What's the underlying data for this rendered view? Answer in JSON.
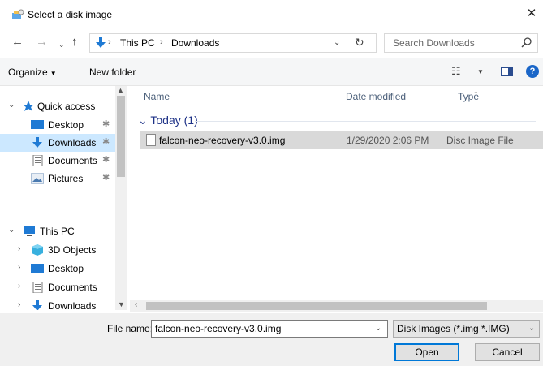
{
  "window": {
    "title": "Select a disk image",
    "close_glyph": "✕"
  },
  "nav": {
    "back": "←",
    "forward": "→",
    "recent": "⌄",
    "up": "↑",
    "address": {
      "sep": "›",
      "parts": [
        "This PC",
        "Downloads"
      ],
      "dropdown": "⌄",
      "refresh": "↻"
    },
    "search_placeholder": "Search Downloads"
  },
  "toolbar": {
    "organize": "Organize",
    "organize_caret": "▼",
    "new_folder": "New folder",
    "view_glyph": "☷",
    "view_caret": "▼",
    "help": "?"
  },
  "sidebar": {
    "quick_access": "Quick access",
    "quick_items": [
      {
        "label": "Desktop",
        "icon": "desktop-icon"
      },
      {
        "label": "Downloads",
        "icon": "downloads-icon",
        "selected": true
      },
      {
        "label": "Documents",
        "icon": "documents-icon"
      },
      {
        "label": "Pictures",
        "icon": "pictures-icon"
      }
    ],
    "pin": "✱",
    "this_pc": "This PC",
    "pc_items": [
      {
        "label": "3D Objects",
        "icon": "3d-objects-icon"
      },
      {
        "label": "Desktop",
        "icon": "desktop-icon"
      },
      {
        "label": "Documents",
        "icon": "documents-icon"
      },
      {
        "label": "Downloads",
        "icon": "downloads-icon"
      }
    ],
    "chev_open": "⌄",
    "chev_closed": "›"
  },
  "filelist": {
    "columns": {
      "name": "Name",
      "date": "Date modified",
      "type": "Type"
    },
    "group": "Today (1)",
    "group_chev": "⌄",
    "files": [
      {
        "name": "falcon-neo-recovery-v3.0.img",
        "date": "1/29/2020 2:06 PM",
        "type": "Disc Image File"
      }
    ]
  },
  "footer": {
    "filename_label": "File name:",
    "filename_value": "falcon-neo-recovery-v3.0.img",
    "filter": "Disk Images (*.img *.IMG)",
    "open": "Open",
    "cancel": "Cancel",
    "drop": "⌄"
  },
  "colors": {
    "accent": "#0078d7",
    "selected_bg": "#cce8ff",
    "group_header": "#1e3287",
    "folder_blue": "#1f7ad4"
  }
}
